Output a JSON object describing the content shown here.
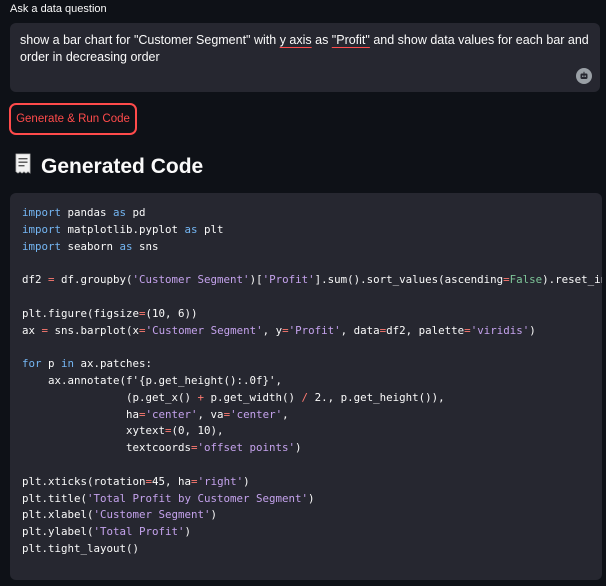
{
  "question": {
    "label": "Ask a data question",
    "text_before": "show a bar chart for \"Customer Segment\" with ",
    "text_spell1": "y axis",
    "text_mid": " as ",
    "text_spell2": "\"Profit\"",
    "text_after": " and show data values for each bar and order in decreasing order"
  },
  "button": {
    "label": "Generate & Run Code"
  },
  "section": {
    "title": "Generated Code",
    "icon": "receipt-icon"
  },
  "code": {
    "l1": [
      "import",
      " pandas ",
      "as",
      " pd"
    ],
    "l2": [
      "import",
      " matplotlib.pyplot ",
      "as",
      " plt"
    ],
    "l3": [
      "import",
      " seaborn ",
      "as",
      " sns"
    ],
    "l5a": "df2 ",
    "l5b": "=",
    "l5c": " df.groupby(",
    "l5d": "'Customer Segment'",
    "l5e": ")[",
    "l5f": "'Profit'",
    "l5g": "].sum().sort_values(ascending",
    "l5h": "=",
    "l5i": "False",
    "l5j": ").reset_inde",
    "l7a": "plt.figure(figsize",
    "l7b": "=",
    "l7c": "(10, 6))",
    "l8a": "ax ",
    "l8b": "=",
    "l8c": " sns.barplot(x",
    "l8d": "=",
    "l8e": "'Customer Segment'",
    "l8f": ", y",
    "l8g": "=",
    "l8h": "'Profit'",
    "l8i": ", data",
    "l8j": "=",
    "l8k": "df2, palette",
    "l8l": "=",
    "l8m": "'viridis'",
    "l8n": ")",
    "l10a": "for",
    "l10b": " p ",
    "l10c": "in",
    "l10d": " ax.patches:",
    "l11a": "    ax.annotate(f'{p.get_height():.0f}',",
    "l12a": "                (p.get_x() ",
    "l12b": "+",
    "l12c": " p.get_width() ",
    "l12d": "/",
    "l12e": " 2., p.get_height()),",
    "l13a": "                ha",
    "l13b": "=",
    "l13c": "'center'",
    "l13d": ", va",
    "l13e": "=",
    "l13f": "'center'",
    "l13g": ",",
    "l14a": "                xytext",
    "l14b": "=",
    "l14c": "(0, 10),",
    "l15a": "                textcoords",
    "l15b": "=",
    "l15c": "'offset points'",
    "l15d": ")",
    "l17a": "plt.xticks(rotation",
    "l17b": "=",
    "l17c": "45, ha",
    "l17d": "=",
    "l17e": "'right'",
    "l17f": ")",
    "l18a": "plt.title(",
    "l18b": "'Total Profit by Customer Segment'",
    "l18c": ")",
    "l19a": "plt.xlabel(",
    "l19b": "'Customer Segment'",
    "l19c": ")",
    "l20a": "plt.ylabel(",
    "l20b": "'Total Profit'",
    "l20c": ")",
    "l21a": "plt.tight_layout()"
  }
}
